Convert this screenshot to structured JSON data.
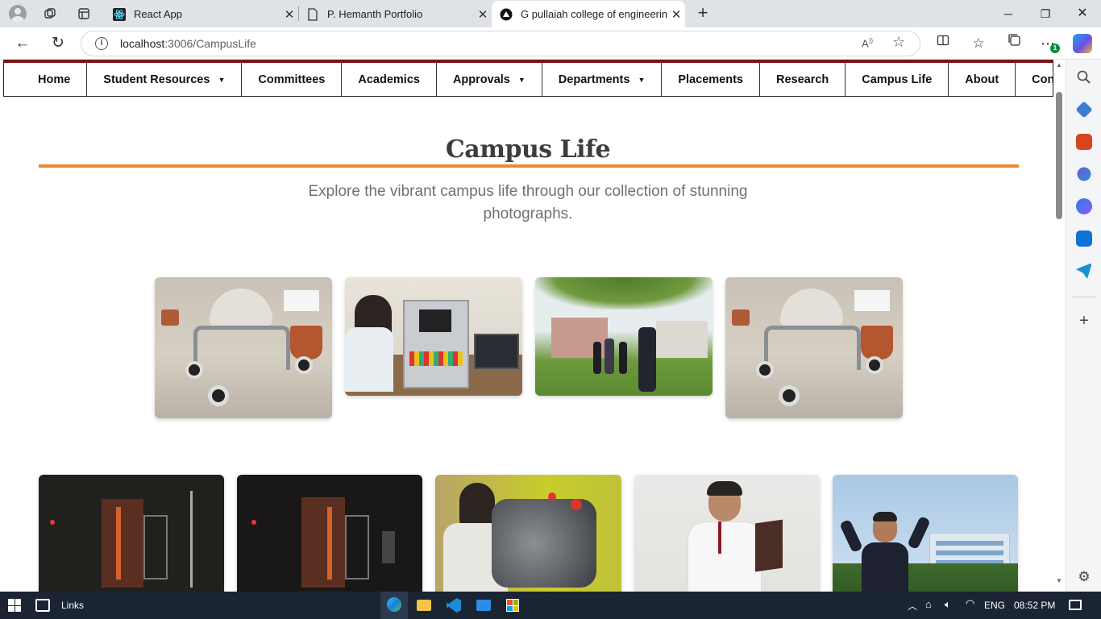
{
  "browser": {
    "tabs": [
      {
        "title": "React App",
        "icon": "react-icon",
        "active": false
      },
      {
        "title": "P. Hemanth Portfolio",
        "icon": "document-icon",
        "active": false
      },
      {
        "title": "G pullaiah college of engineering",
        "icon": "app-logo-icon",
        "active": true
      }
    ],
    "url_host": "localhost",
    "url_path": ":3006/CampusLife",
    "extension_badge": "1"
  },
  "navbar": {
    "items": [
      {
        "label": "Home",
        "dropdown": false
      },
      {
        "label": "Student Resources",
        "dropdown": true
      },
      {
        "label": "Committees",
        "dropdown": false
      },
      {
        "label": "Academics",
        "dropdown": false
      },
      {
        "label": "Approvals",
        "dropdown": true
      },
      {
        "label": "Departments",
        "dropdown": true
      },
      {
        "label": "Placements",
        "dropdown": false
      },
      {
        "label": "Research",
        "dropdown": false
      },
      {
        "label": "Campus Life",
        "dropdown": false
      },
      {
        "label": "About",
        "dropdown": false
      },
      {
        "label": "Contact",
        "dropdown": false
      }
    ],
    "accent_color": "#7a1416"
  },
  "page": {
    "title": "Campus Life",
    "subtitle": "Explore the vibrant campus life through our collection of stunning photographs.",
    "accent_color": "#e98a2d"
  },
  "gallery": {
    "row1": [
      "robot-rover-photo",
      "student-lab-equipment-photo",
      "campus-group-photo",
      "robot-rover-photo"
    ],
    "row2": [
      "lab-apparatus-photo",
      "lab-apparatus-photo",
      "engine-workshop-photo",
      "student-laptop-photo",
      "student-celebrating-photo"
    ]
  },
  "taskbar": {
    "links_label": "Links",
    "language": "ENG",
    "time": "08:52 PM"
  }
}
